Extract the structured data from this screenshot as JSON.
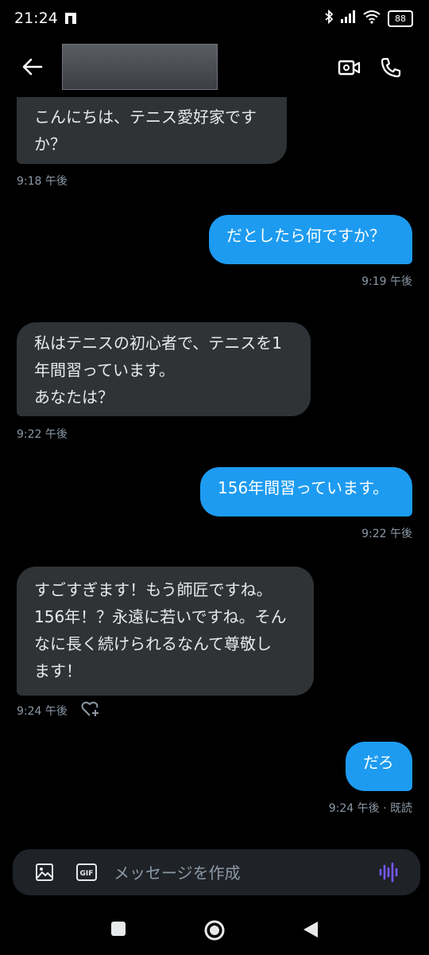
{
  "status": {
    "time": "21:24",
    "battery": "88"
  },
  "header": {
    "back_icon": "arrow-left-icon",
    "video_icon": "video-camera-icon",
    "call_icon": "phone-icon"
  },
  "messages": [
    {
      "type": "in",
      "lines": [
        "こんにちは、テニス愛好家です",
        "か？"
      ],
      "time": "9:18 午後"
    },
    {
      "type": "out",
      "lines": [
        "だとしたら何ですか？"
      ],
      "time": "9:19 午後"
    },
    {
      "type": "in",
      "lines": [
        "私はテニスの初心者で、テニスを1",
        "年間習っています。",
        "あなたは？"
      ],
      "time": "9:22 午後"
    },
    {
      "type": "out",
      "lines": [
        "156年間習っています。"
      ],
      "time": "9:22 午後"
    },
    {
      "type": "in",
      "lines": [
        "すごすぎます！もう師匠ですね。",
        "156年！？永遠に若いですね。そん",
        "なに長く続けられるなんて尊敬し",
        "ます！"
      ],
      "time": "9:24 午後"
    },
    {
      "type": "out",
      "lines": [
        "だろ"
      ],
      "time": "9:24 午後 · 既読"
    }
  ],
  "composer": {
    "placeholder": "メッセージを作成",
    "gif_label": "GIF"
  },
  "colors": {
    "accent": "#1d9bf0",
    "incoming_bubble": "#2f3336",
    "voice": "#7856ff"
  }
}
